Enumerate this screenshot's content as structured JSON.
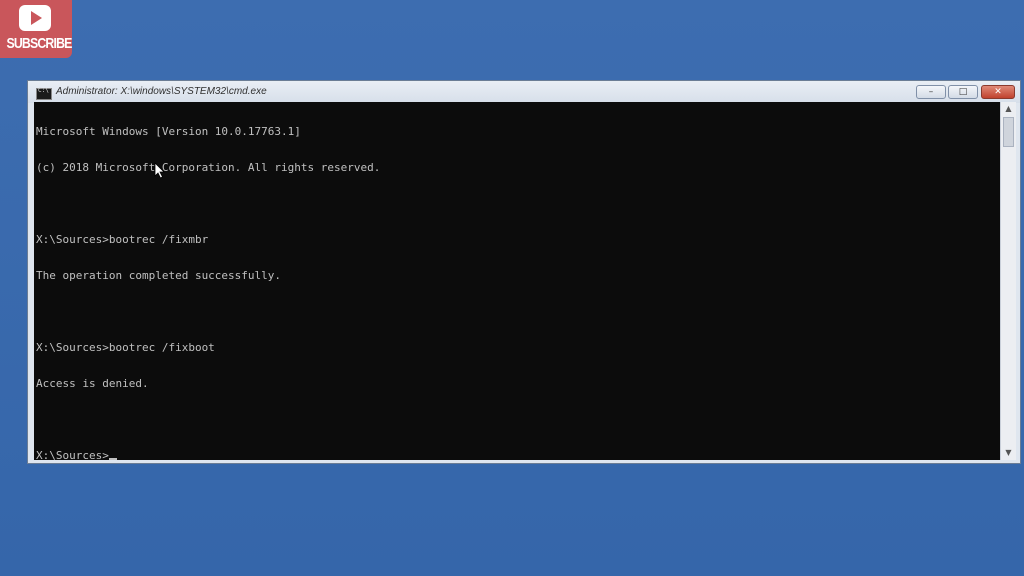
{
  "subscribe": {
    "label": "SUBSCRIBE",
    "icon": "play-icon",
    "color": "#c9565b"
  },
  "window": {
    "title": "Administrator: X:\\windows\\SYSTEM32\\cmd.exe",
    "icon": "cmd-icon",
    "controls": {
      "minimize": "–",
      "maximize": "□",
      "close": "✕"
    }
  },
  "console": {
    "lines": [
      "Microsoft Windows [Version 10.0.17763.1]",
      "(c) 2018 Microsoft Corporation. All rights reserved.",
      "",
      "X:\\Sources>bootrec /fixmbr",
      "The operation completed successfully.",
      "",
      "X:\\Sources>bootrec /fixboot",
      "Access is denied.",
      "",
      "X:\\Sources>"
    ],
    "background": "#0c0c0c",
    "foreground": "#c0c0c0"
  },
  "scrollbar": {
    "up_arrow": "▲",
    "down_arrow": "▼"
  }
}
